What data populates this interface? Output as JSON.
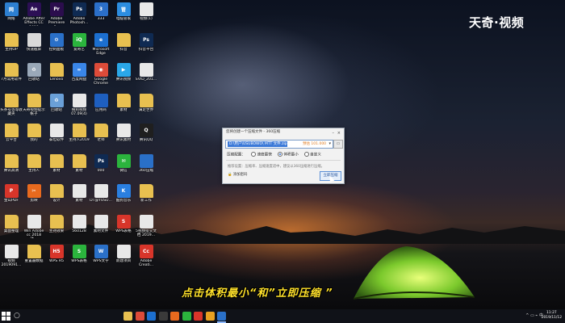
{
  "watermark": "天奇·视频",
  "subtitle": "点击体积最小“和”立即压缩 ”",
  "desktop_icons": [
    {
      "label": "网络",
      "color": "#2d7fd1",
      "glyph": "网"
    },
    {
      "label": "Adobe After Effects CC 2018",
      "color": "#2c0f55",
      "glyph": "Ae"
    },
    {
      "label": "Adobe Premiere P...",
      "color": "#2b0d4d",
      "glyph": "Pr"
    },
    {
      "label": "Adobe Photosh...",
      "color": "#0f2a52",
      "glyph": "Ps"
    },
    {
      "label": "333",
      "color": "#2b6fc9",
      "glyph": "3"
    },
    {
      "label": "电脑管家",
      "color": "#2c8de0",
      "glyph": "管"
    },
    {
      "label": "视频(1)",
      "color": "#e8e8e8",
      "glyph": ""
    },
    {
      "label": "主持OP",
      "color": "#e8c050",
      "glyph": ""
    },
    {
      "label": "快速截屏",
      "color": "#d9d9d9",
      "glyph": ""
    },
    {
      "label": "控制面板",
      "color": "#2a70c8",
      "glyph": "⚙"
    },
    {
      "label": "爱奇艺",
      "color": "#2bb43d",
      "glyph": "iQ"
    },
    {
      "label": "Microsoft Edge",
      "color": "#1c6fd0",
      "glyph": "e"
    },
    {
      "label": "抖音",
      "color": "#e8c050",
      "glyph": ""
    },
    {
      "label": "抖音平台",
      "color": "#0f2a52",
      "glyph": "Ps"
    },
    {
      "label": "7月常用软件",
      "color": "#e8c050",
      "glyph": ""
    },
    {
      "label": "回收站",
      "color": "#9aa8b8",
      "glyph": "♻"
    },
    {
      "label": "Lenovo",
      "color": "#e8c050",
      "glyph": ""
    },
    {
      "label": "百度网盘",
      "color": "#3a86e8",
      "glyph": "∞"
    },
    {
      "label": "Google Chrome",
      "color": "#dd4b39",
      "glyph": "◉"
    },
    {
      "label": "腾讯视频",
      "color": "#2aa7e8",
      "glyph": "▶"
    },
    {
      "label": "SVID_201...",
      "color": "#e8e8e8",
      "glyph": ""
    },
    {
      "label": "头条号等等收藏夹",
      "color": "#e8c050",
      "glyph": ""
    },
    {
      "label": "天奇视频提示帐子",
      "color": "#e8c050",
      "glyph": ""
    },
    {
      "label": "回收站",
      "color": "#6aa0d8",
      "glyph": "♻"
    },
    {
      "label": "搜狗视频 07.09(4)",
      "color": "#e8e8e8",
      "glyph": ""
    },
    {
      "label": "应用商",
      "color": "#1e5fbf",
      "glyph": ""
    },
    {
      "label": "素材",
      "color": "#e8c050",
      "glyph": ""
    },
    {
      "label": "满足世界",
      "color": "#e8c050",
      "glyph": ""
    },
    {
      "label": "云平台",
      "color": "#e8c050",
      "glyph": ""
    },
    {
      "label": "我的",
      "color": "#e8c050",
      "glyph": ""
    },
    {
      "label": "泰坦软件",
      "color": "#e8e8e8",
      "glyph": ""
    },
    {
      "label": "主持人2019",
      "color": "#e8c050",
      "glyph": ""
    },
    {
      "label": "老师",
      "color": "#e8c050",
      "glyph": ""
    },
    {
      "label": "腾讯素材",
      "color": "#e8e8e8",
      "glyph": ""
    },
    {
      "label": "腾讯QQ",
      "color": "#1f1f1f",
      "glyph": "Q"
    },
    {
      "label": "腾讯高清",
      "color": "#e8c050",
      "glyph": ""
    },
    {
      "label": "主持人",
      "color": "#e8c050",
      "glyph": ""
    },
    {
      "label": "素材",
      "color": "#e8c050",
      "glyph": ""
    },
    {
      "label": "素材",
      "color": "#e8c050",
      "glyph": ""
    },
    {
      "label": "000",
      "color": "#0f2a52",
      "glyph": "Ps"
    },
    {
      "label": "微信",
      "color": "#2bb43d",
      "glyph": "✉"
    },
    {
      "label": "360压缩",
      "color": "#2a70c8",
      "glyph": ""
    },
    {
      "label": "金山PDF",
      "color": "#d8352a",
      "glyph": "P"
    },
    {
      "label": "剪映",
      "color": "#e86a1e",
      "glyph": "✂"
    },
    {
      "label": "设计",
      "color": "#e8c050",
      "glyph": ""
    },
    {
      "label": "素材",
      "color": "#e8e8e8",
      "glyph": ""
    },
    {
      "label": "DT@YUSU...",
      "color": "#e8e8e8",
      "glyph": ""
    },
    {
      "label": "酷狗音乐",
      "color": "#2a7fe0",
      "glyph": "K"
    },
    {
      "label": "新工作",
      "color": "#e8c050",
      "glyph": ""
    },
    {
      "label": "桌面整理",
      "color": "#e8c050",
      "glyph": ""
    },
    {
      "label": "Win Adobe cc 2018 注...",
      "color": "#e8e8e8",
      "glyph": ""
    },
    {
      "label": "主持效果",
      "color": "#e8c050",
      "glyph": ""
    },
    {
      "label": "560128",
      "color": "#e8e8e8",
      "glyph": ""
    },
    {
      "label": "素材文件",
      "color": "#e8e8e8",
      "glyph": ""
    },
    {
      "label": "WPS表格",
      "color": "#d8352a",
      "glyph": "S"
    },
    {
      "label": "5视频提交文档 2019...",
      "color": "#e8e8e8",
      "glyph": ""
    },
    {
      "label": "视频 2019091...",
      "color": "#e8e8e8",
      "glyph": ""
    },
    {
      "label": "重置器数据",
      "color": "#e8c050",
      "glyph": ""
    },
    {
      "label": "WPS H5",
      "color": "#d8352a",
      "glyph": "H5"
    },
    {
      "label": "WPS表格",
      "color": "#2bb43d",
      "glyph": "S"
    },
    {
      "label": "WPS文字",
      "color": "#2a70c8",
      "glyph": "W"
    },
    {
      "label": "新建项目",
      "color": "#e8e8e8",
      "glyph": ""
    },
    {
      "label": "Adobe Creati...",
      "color": "#d8352a",
      "glyph": "Cc"
    }
  ],
  "dialog": {
    "title": "您将创建一个压缩文件 - 360压缩",
    "path": "D:\\用户\\USUBOWO\\ MTT 文件.zip",
    "size": "预估 101.000",
    "compress_label": "压缩配置：",
    "options": [
      "速度最快",
      "体积最小",
      "自定义"
    ],
    "selected_option": 1,
    "hint": "推荐设置：压缩率、压缩速度适中，建议以360压缩进行压缩。",
    "encrypt_label": "添加密码",
    "start_button": "立即压缩"
  },
  "taskbar": {
    "search_icon": "search-icon",
    "apps": [
      "file-explorer-icon",
      "chrome-icon",
      "edge-icon",
      "store-icon",
      "app-icon-a",
      "app-icon-b",
      "app-icon-c",
      "app-icon-d",
      "compress-icon"
    ],
    "tray": "^ ▭ ⌁ 中",
    "time": "11:27",
    "date": "2019/11/12"
  }
}
